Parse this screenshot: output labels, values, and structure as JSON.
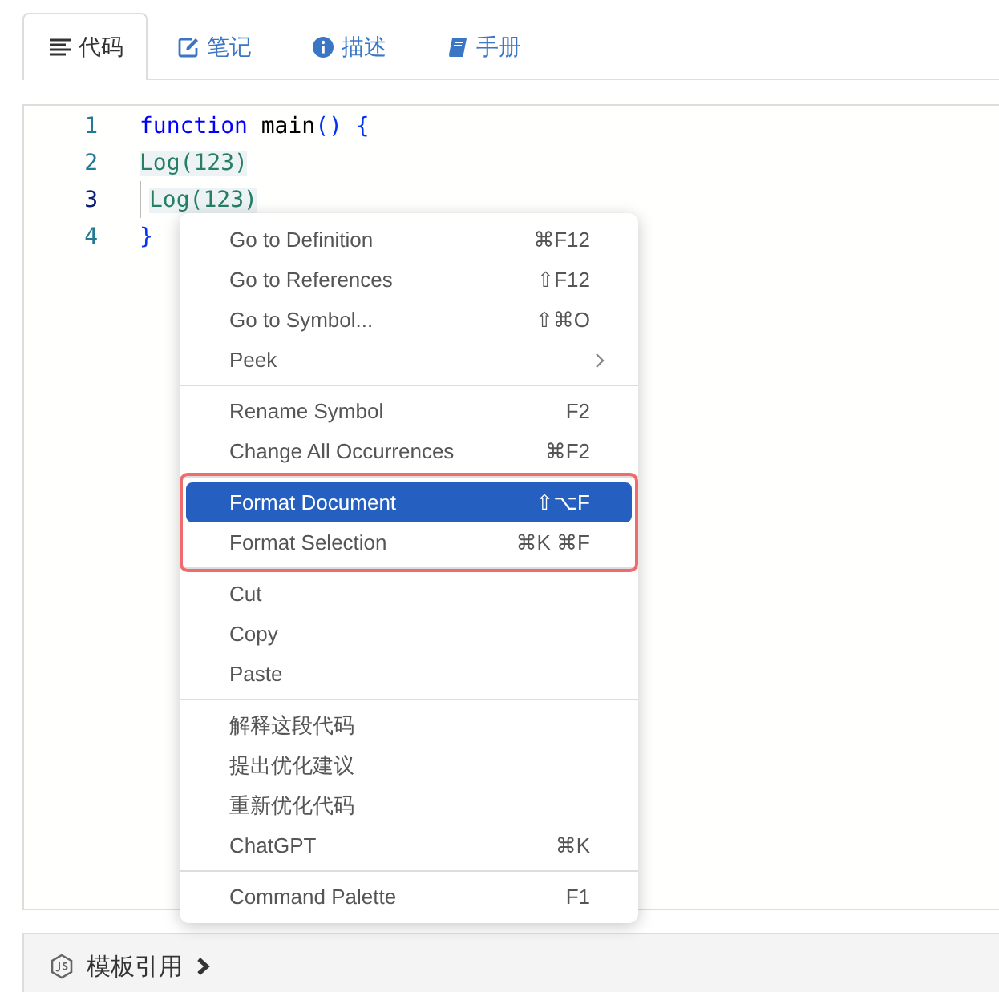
{
  "tabs": [
    {
      "label": "代码",
      "selected": true
    },
    {
      "label": "笔记",
      "selected": false
    },
    {
      "label": "描述",
      "selected": false
    },
    {
      "label": "手册",
      "selected": false
    }
  ],
  "editor": {
    "lines": [
      {
        "number": "1",
        "current": false,
        "indented": false,
        "tokens": [
          {
            "text": "function",
            "kind": "keyword",
            "highlighted": false
          },
          {
            "text": " main",
            "kind": "plain",
            "highlighted": false
          },
          {
            "text": "()",
            "kind": "bracket",
            "highlighted": false
          },
          {
            "text": " {",
            "kind": "bracket",
            "highlighted": false
          }
        ]
      },
      {
        "number": "2",
        "current": false,
        "indented": false,
        "tokens": [
          {
            "text": "Log(123)",
            "kind": "call",
            "highlighted": true
          }
        ]
      },
      {
        "number": "3",
        "current": true,
        "indented": true,
        "tokens": [
          {
            "text": "Log(123)",
            "kind": "call",
            "highlighted": true
          }
        ]
      },
      {
        "number": "4",
        "current": false,
        "indented": false,
        "tokens": [
          {
            "text": "}",
            "kind": "bracket",
            "highlighted": false
          }
        ]
      }
    ]
  },
  "context_menu": {
    "groups": [
      {
        "outlined": false,
        "items": [
          {
            "label": "Go to Definition",
            "shortcut": "⌘F12",
            "kind": "command",
            "selected": false
          },
          {
            "label": "Go to References",
            "shortcut": "⇧F12",
            "kind": "command",
            "selected": false
          },
          {
            "label": "Go to Symbol...",
            "shortcut": "⇧⌘O",
            "kind": "command",
            "selected": false
          },
          {
            "label": "Peek",
            "kind": "submenu",
            "selected": false
          }
        ]
      },
      {
        "outlined": false,
        "items": [
          {
            "label": "Rename Symbol",
            "shortcut": "F2",
            "kind": "command",
            "selected": false
          },
          {
            "label": "Change All Occurrences",
            "shortcut": "⌘F2",
            "kind": "command",
            "selected": false
          }
        ]
      },
      {
        "outlined": true,
        "items": [
          {
            "label": "Format Document",
            "shortcut": "⇧⌥F",
            "kind": "command",
            "selected": true
          },
          {
            "label": "Format Selection",
            "shortcut": "⌘K ⌘F",
            "kind": "command",
            "selected": false
          }
        ]
      },
      {
        "outlined": false,
        "items": [
          {
            "label": "Cut",
            "kind": "command",
            "selected": false
          },
          {
            "label": "Copy",
            "kind": "command",
            "selected": false
          },
          {
            "label": "Paste",
            "kind": "command",
            "selected": false
          }
        ]
      },
      {
        "outlined": false,
        "items": [
          {
            "label": "解释这段代码",
            "kind": "command",
            "selected": false
          },
          {
            "label": "提出优化建议",
            "kind": "command",
            "selected": false
          },
          {
            "label": "重新优化代码",
            "kind": "command",
            "selected": false
          },
          {
            "label": "ChatGPT",
            "shortcut": "⌘K",
            "kind": "command",
            "selected": false
          }
        ]
      },
      {
        "outlined": false,
        "items": [
          {
            "label": "Command Palette",
            "shortcut": "F1",
            "kind": "command",
            "selected": false
          }
        ]
      }
    ]
  },
  "footer": {
    "title": "模板引用"
  }
}
